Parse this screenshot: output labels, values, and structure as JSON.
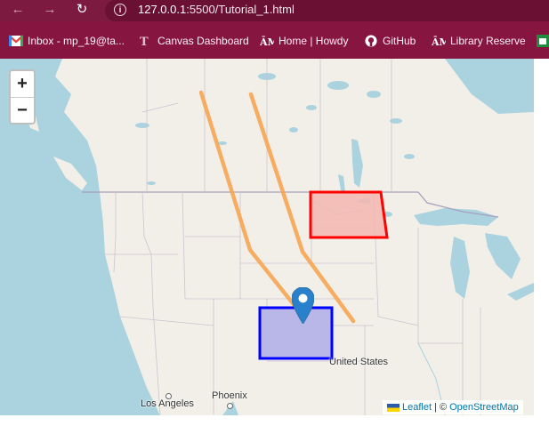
{
  "browser": {
    "back_icon": "arrow-left-icon",
    "forward_icon": "arrow-right-icon",
    "reload_icon": "reload-icon",
    "info_icon": "info-icon",
    "url_host": "127.0.0.1",
    "url_rest": ":5500/Tutorial_1.html"
  },
  "bookmarks": [
    {
      "label": "Inbox - mp_19@ta...",
      "icon": "gmail-icon"
    },
    {
      "label": "Canvas Dashboard",
      "icon": "canvas-icon"
    },
    {
      "label": "Home | Howdy",
      "icon": "tamu-icon"
    },
    {
      "label": "GitHub",
      "icon": "github-icon"
    },
    {
      "label": "Library Reserve",
      "icon": "tamu-icon"
    }
  ],
  "map": {
    "zoom_in": "+",
    "zoom_out": "−",
    "labels": {
      "united_states": "United States",
      "phoenix": "Phoenix",
      "los_angeles": "Los Angeles"
    },
    "attribution": {
      "leaflet": "Leaflet",
      "separator": "| ©",
      "osm": "OpenStreetMap"
    },
    "colors": {
      "polyline": "#f7a552",
      "red_rect_stroke": "#ff0000",
      "red_rect_fill": "#f6b6b0",
      "blue_rect_stroke": "#0000ff",
      "blue_rect_fill": "#b9b6e8",
      "water": "#aad3df",
      "land": "#f2efe9",
      "marker": "#2a81cb"
    }
  }
}
